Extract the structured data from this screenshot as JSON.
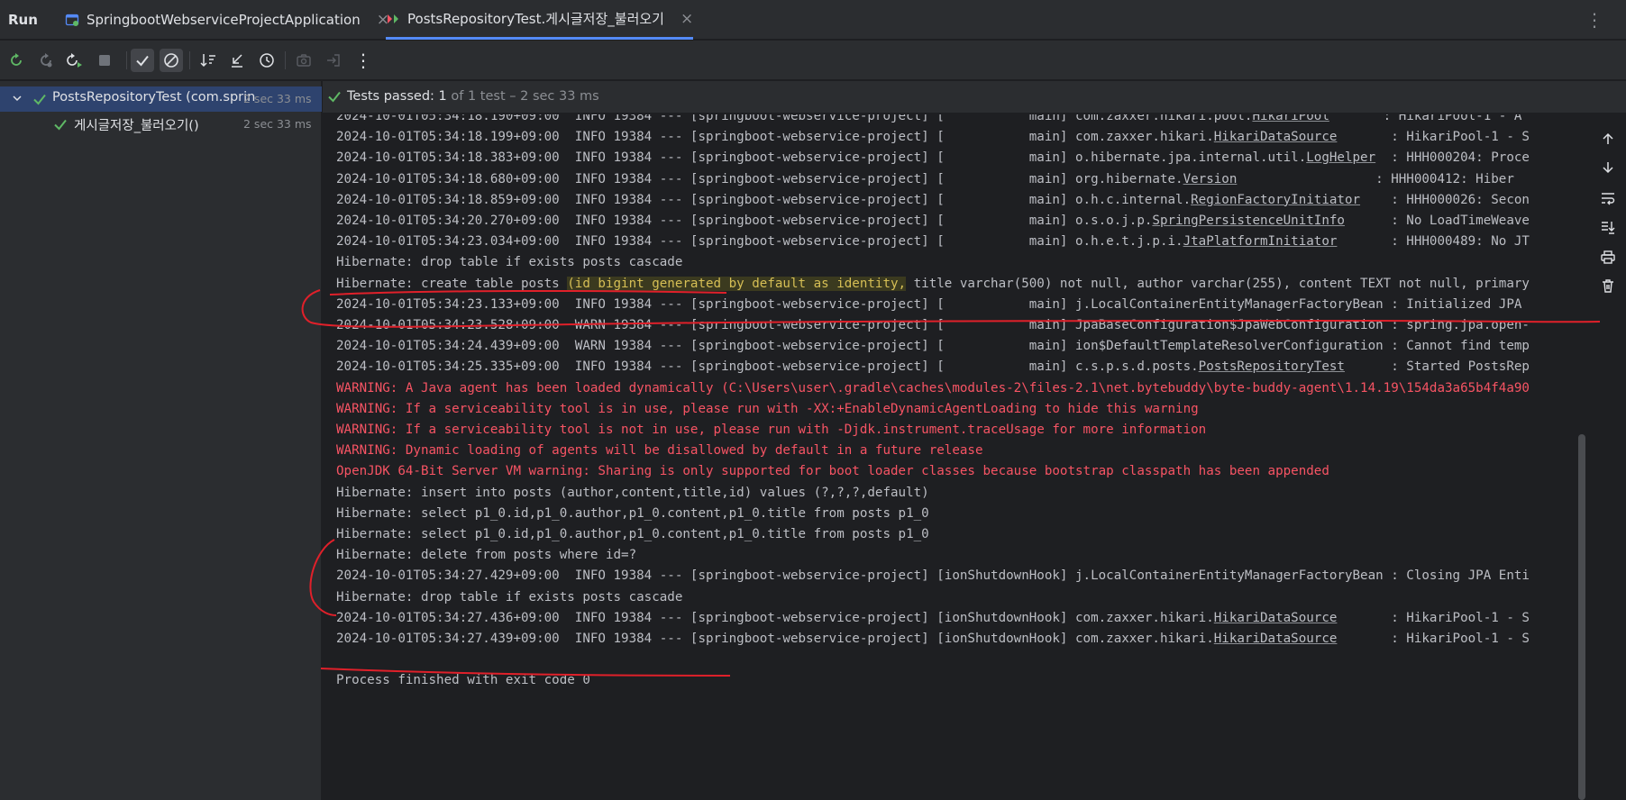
{
  "tabbar": {
    "run_title": "Run",
    "tabs": [
      {
        "label": "SpringbootWebserviceProjectApplication",
        "icon": "app-config-icon"
      },
      {
        "label": "PostsRepositoryTest.게시글저장_불러오기",
        "icon": "junit-test-icon"
      }
    ],
    "more": "⋮"
  },
  "toolbar": {
    "buttons": [
      "rerun-icon",
      "rerun-failed-icon",
      "rerun-pipeline-icon",
      "stop-icon",
      "show-passed-icon",
      "show-ignored-icon",
      "sort-icon",
      "collapse-icon",
      "history-icon",
      "screenshot-icon",
      "export-icon",
      "more-icon"
    ],
    "more": "⋮"
  },
  "tree": {
    "items": [
      {
        "label": "PostsRepositoryTest (com.sprin",
        "time": "2 sec 33 ms"
      },
      {
        "label": "게시글저장_불러오기()",
        "time": "2 sec 33 ms"
      }
    ]
  },
  "status": {
    "passed": "Tests passed: 1",
    "detail": " of 1 test – 2 sec 33 ms"
  },
  "console": {
    "lines": [
      {
        "type": "info",
        "pre": "2024-10-01T05:34:18.190+09:00  INFO 19384 --- [springboot-webservice-project] [           main] com.zaxxer.hikari.pool.",
        "u": "HikariPool",
        "post": "       : HikariPool-1 - A"
      },
      {
        "type": "info",
        "pre": "2024-10-01T05:34:18.199+09:00  INFO 19384 --- [springboot-webservice-project] [           main] com.zaxxer.hikari.",
        "u": "HikariDataSource",
        "post": "       : HikariPool-1 - S"
      },
      {
        "type": "info",
        "pre": "2024-10-01T05:34:18.383+09:00  INFO 19384 --- [springboot-webservice-project] [           main] o.hibernate.jpa.internal.util.",
        "u": "LogHelper",
        "post": "  : HHH000204: Proce"
      },
      {
        "type": "info",
        "pre": "2024-10-01T05:34:18.680+09:00  INFO 19384 --- [springboot-webservice-project] [           main] org.hibernate.",
        "u": "Version",
        "post": "                  : HHH000412: Hiber"
      },
      {
        "type": "info",
        "pre": "2024-10-01T05:34:18.859+09:00  INFO 19384 --- [springboot-webservice-project] [           main] o.h.c.internal.",
        "u": "RegionFactoryInitiator",
        "post": "    : HHH000026: Secon"
      },
      {
        "type": "info",
        "pre": "2024-10-01T05:34:20.270+09:00  INFO 19384 --- [springboot-webservice-project] [           main] o.s.o.j.p.",
        "u": "SpringPersistenceUnitInfo",
        "post": "      : No LoadTimeWeave"
      },
      {
        "type": "info",
        "pre": "2024-10-01T05:34:23.034+09:00  INFO 19384 --- [springboot-webservice-project] [           main] o.h.e.t.j.p.i.",
        "u": "JtaPlatformInitiator",
        "post": "       : HHH000489: No JT"
      },
      {
        "type": "plain",
        "text": "Hibernate: drop table if exists posts cascade"
      },
      {
        "type": "hl",
        "pre": "Hibernate: create table posts ",
        "hl": "(id bigint generated by default as identity,",
        "post": " title varchar(500) not null, author varchar(255), content TEXT not null, primary"
      },
      {
        "type": "info",
        "pre": "2024-10-01T05:34:23.133+09:00  INFO 19384 --- [springboot-webservice-project] [           main] j.LocalContainerEntityManagerFactoryBean : Initialized JPA ",
        "u": "",
        "post": ""
      },
      {
        "type": "info",
        "pre": "2024-10-01T05:34:23.528+09:00  WARN 19384 --- [springboot-webservice-project] [           main] JpaBaseConfiguration$JpaWebConfiguration : spring.jpa.open-",
        "u": "",
        "post": ""
      },
      {
        "type": "info",
        "pre": "2024-10-01T05:34:24.439+09:00  WARN 19384 --- [springboot-webservice-project] [           main] ion$DefaultTemplateResolverConfiguration : Cannot find temp",
        "u": "",
        "post": ""
      },
      {
        "type": "info",
        "pre": "2024-10-01T05:34:25.335+09:00  INFO 19384 --- [springboot-webservice-project] [           main] c.s.p.s.d.posts.",
        "u": "PostsRepositoryTest",
        "post": "      : Started PostsRep"
      },
      {
        "type": "err",
        "text": "WARNING: A Java agent has been loaded dynamically (C:\\Users\\user\\.gradle\\caches\\modules-2\\files-2.1\\net.bytebuddy\\byte-buddy-agent\\1.14.19\\154da3a65b4f4a90"
      },
      {
        "type": "err",
        "text": "WARNING: If a serviceability tool is in use, please run with -XX:+EnableDynamicAgentLoading to hide this warning"
      },
      {
        "type": "err",
        "text": "WARNING: If a serviceability tool is not in use, please run with -Djdk.instrument.traceUsage for more information"
      },
      {
        "type": "err",
        "text": "WARNING: Dynamic loading of agents will be disallowed by default in a future release"
      },
      {
        "type": "err",
        "text": "OpenJDK 64-Bit Server VM warning: Sharing is only supported for boot loader classes because bootstrap classpath has been appended"
      },
      {
        "type": "plain",
        "text": "Hibernate: insert into posts (author,content,title,id) values (?,?,?,default)"
      },
      {
        "type": "plain",
        "text": "Hibernate: select p1_0.id,p1_0.author,p1_0.content,p1_0.title from posts p1_0"
      },
      {
        "type": "plain",
        "text": "Hibernate: select p1_0.id,p1_0.author,p1_0.content,p1_0.title from posts p1_0"
      },
      {
        "type": "plain",
        "text": "Hibernate: delete from posts where id=?"
      },
      {
        "type": "info",
        "pre": "2024-10-01T05:34:27.429+09:00  INFO 19384 --- [springboot-webservice-project] [ionShutdownHook] j.LocalContainerEntityManagerFactoryBean : Closing JPA Enti",
        "u": "",
        "post": ""
      },
      {
        "type": "plain",
        "text": "Hibernate: drop table if exists posts cascade"
      },
      {
        "type": "info",
        "pre": "2024-10-01T05:34:27.436+09:00  INFO 19384 --- [springboot-webservice-project] [ionShutdownHook] com.zaxxer.hikari.",
        "u": "HikariDataSource",
        "post": "       : HikariPool-1 - S"
      },
      {
        "type": "info",
        "pre": "2024-10-01T05:34:27.439+09:00  INFO 19384 --- [springboot-webservice-project] [ionShutdownHook] com.zaxxer.hikari.",
        "u": "HikariDataSource",
        "post": "       : HikariPool-1 - S"
      },
      {
        "type": "plain",
        "text": ""
      },
      {
        "type": "plain",
        "text": "Process finished with exit code 0"
      }
    ]
  },
  "side_tools": [
    "scroll-up-icon",
    "scroll-down-icon",
    "soft-wrap-icon",
    "scroll-to-end-icon",
    "print-icon",
    "trash-icon"
  ],
  "colors": {
    "accent": "#548af7",
    "success": "#5fb865",
    "error": "#f75464",
    "annotation": "#e0202a"
  }
}
